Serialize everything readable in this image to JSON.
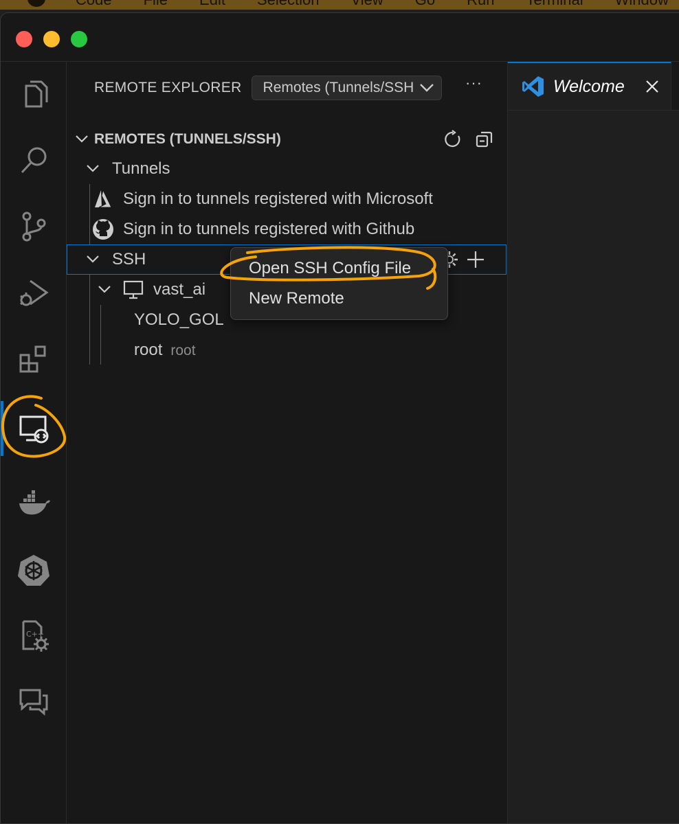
{
  "menubar": {
    "items": [
      "Code",
      "File",
      "Edit",
      "Selection",
      "View",
      "Go",
      "Run",
      "Terminal",
      "Window"
    ]
  },
  "sidebar": {
    "title": "REMOTE EXPLORER",
    "dropdown_value": "Remotes (Tunnels/SSH",
    "more_label": "···",
    "section_title": "REMOTES (TUNNELS/SSH)",
    "tunnels_label": "Tunnels",
    "tunnel_microsoft": "Sign in to tunnels registered with Microsoft",
    "tunnel_github": "Sign in to tunnels registered with Github",
    "ssh_label": "SSH",
    "host_label": "vast_ai",
    "folder_label": "YOLO_GOL",
    "user_label": "root",
    "user_secondary": "root"
  },
  "context_menu": {
    "items": [
      "Open SSH Config File",
      "New Remote"
    ]
  },
  "editor": {
    "tab_label": "Welcome"
  },
  "colors": {
    "accent": "#0078d4",
    "annotation": "#f5a30a"
  }
}
